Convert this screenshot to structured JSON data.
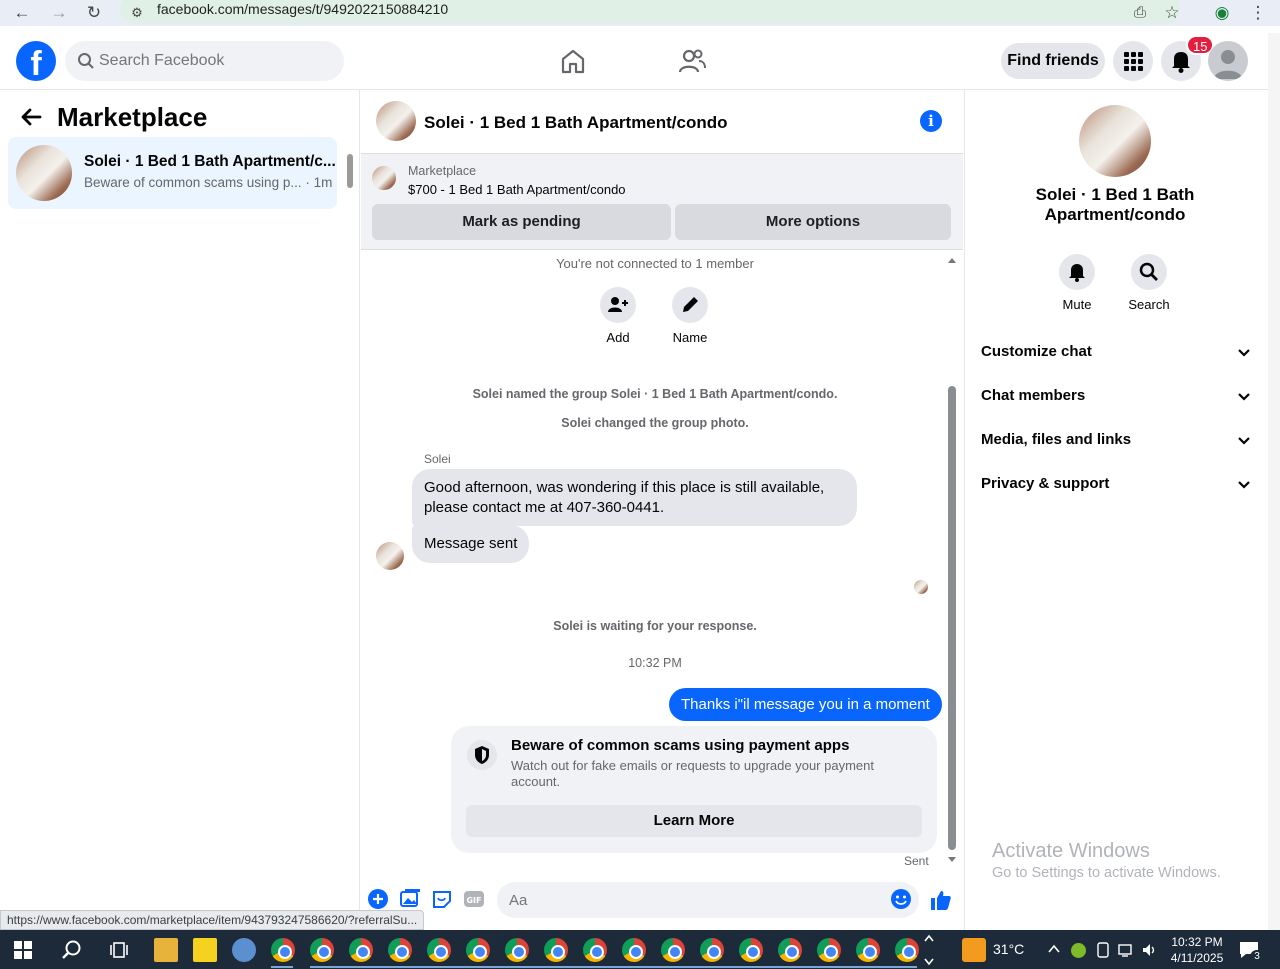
{
  "browser": {
    "url": "facebook.com/messages/t/9492022150884210",
    "status_url": "https://www.facebook.com/marketplace/item/943793247586620/?referralSu..."
  },
  "header": {
    "search_placeholder": "Search Facebook",
    "find_friends": "Find friends",
    "notification_count": "15",
    "brand_color": "#0866ff"
  },
  "left": {
    "title": "Marketplace",
    "conversation": {
      "name": "Solei · 1 Bed 1 Bath Apartment/c...",
      "preview": "Beware of common scams using p... · 1m"
    }
  },
  "chat": {
    "title": "Solei · 1 Bed 1 Bath Apartment/condo",
    "marketplace_label": "Marketplace",
    "listing": "$700 - 1 Bed 1 Bath Apartment/condo",
    "mark_pending": "Mark as pending",
    "more_options": "More options",
    "not_connected": "You're not connected to 1 member",
    "add_label": "Add",
    "name_label": "Name",
    "sys_named": "Solei named the group Solei · 1 Bed 1 Bath Apartment/condo.",
    "sys_photo": "Solei changed the group photo.",
    "sender": "Solei",
    "msg1": "Good afternoon, was wondering if this place is still available, please contact me at 407-360-0441.",
    "msg2": "Message sent",
    "waiting": "Solei is waiting for your response.",
    "time": "10:32 PM",
    "my_msg": "Thanks i\"il message you in a moment",
    "scam_title": "Beware of common scams using payment apps",
    "scam_body": "Watch out for fake emails or requests to upgrade your payment account.",
    "learn_more": "Learn More",
    "sent": "Sent",
    "input_placeholder": "Aa"
  },
  "right": {
    "title": "Solei · 1 Bed 1 Bath Apartment/condo",
    "mute": "Mute",
    "search": "Search",
    "sections": [
      "Customize chat",
      "Chat members",
      "Media, files and links",
      "Privacy & support"
    ],
    "activate_title": "Activate Windows",
    "activate_sub": "Go to Settings to activate Windows."
  },
  "taskbar": {
    "temperature": "31°C",
    "time": "10:32 PM",
    "date": "4/11/2025",
    "notif_count": "3"
  }
}
